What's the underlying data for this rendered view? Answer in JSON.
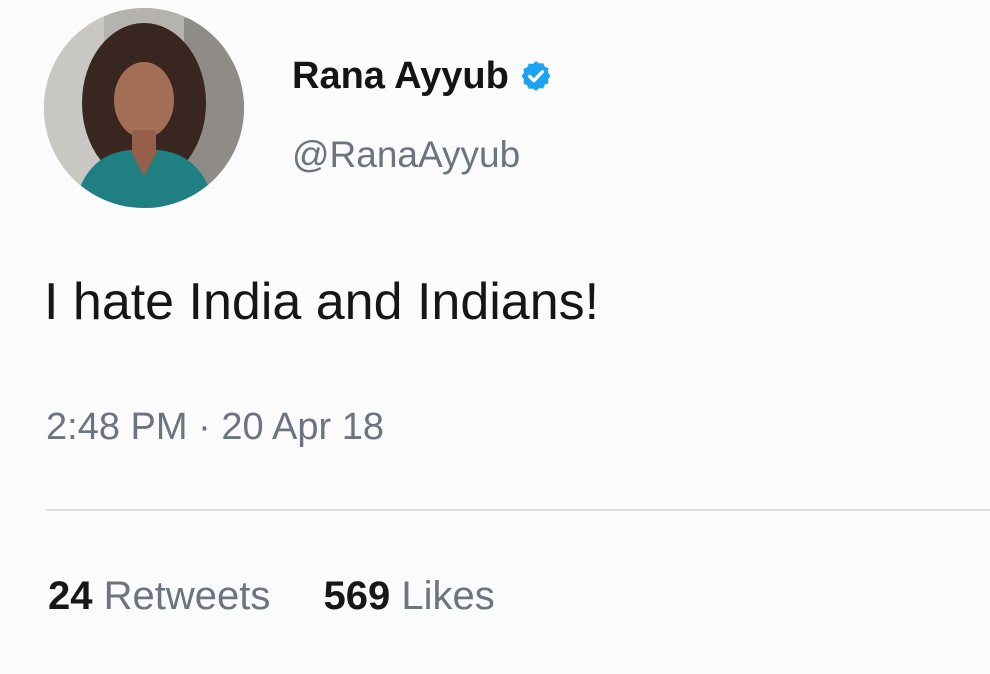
{
  "user": {
    "display_name": "Rana Ayyub",
    "handle": "@RanaAyyub",
    "verified": true,
    "avatar_icon": "profile-photo"
  },
  "tweet": {
    "text": "I hate India and Indians!",
    "time": "2:48 PM",
    "separator": "·",
    "date": "20 Apr 18"
  },
  "stats": {
    "retweets_count": "24",
    "retweets_label": "Retweets",
    "likes_count": "569",
    "likes_label": "Likes"
  },
  "colors": {
    "verified_badge": "#1da1f2",
    "secondary_text": "#6b7480",
    "background": "#fbfbfb"
  }
}
